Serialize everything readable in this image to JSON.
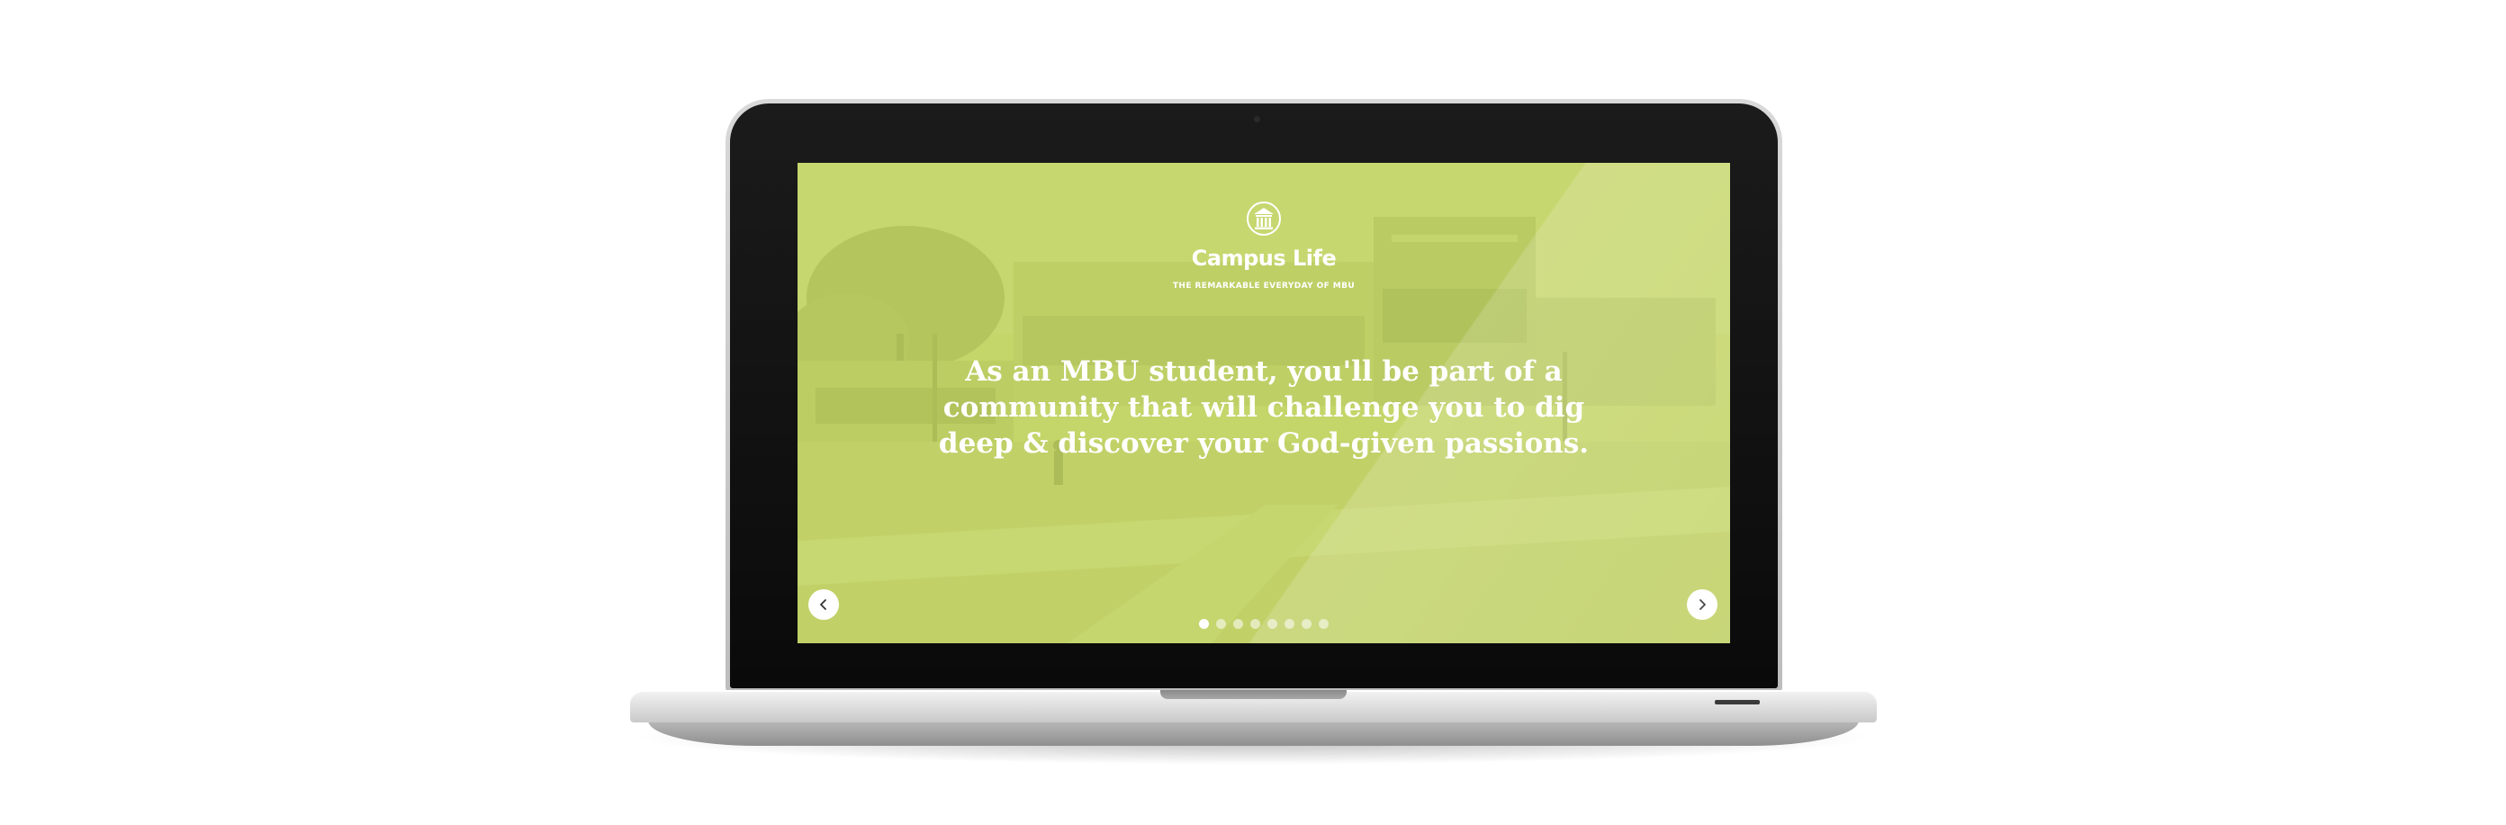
{
  "slide": {
    "section_title": "Campus Life",
    "tagline": "THE REMARKABLE EVERYDAY OF MBU",
    "headline_lines": [
      "As an MBU student, you'll be part of a",
      "community that will challenge you to dig",
      "deep & discover your God-given passions."
    ],
    "overlay_color": "#c6d66f"
  },
  "carousel": {
    "prev_icon": "chevron-left-icon",
    "next_icon": "chevron-right-icon",
    "slide_count": 8,
    "active_index": 0
  }
}
